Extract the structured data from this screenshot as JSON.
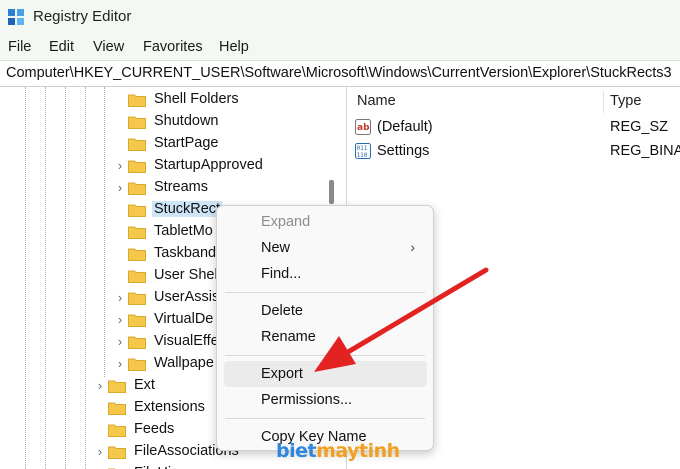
{
  "window": {
    "title": "Registry Editor",
    "app_icon": "registry-editor-icon"
  },
  "menu": [
    "File",
    "Edit",
    "View",
    "Favorites",
    "Help"
  ],
  "address": "Computer\\HKEY_CURRENT_USER\\Software\\Microsoft\\Windows\\CurrentVersion\\Explorer\\StuckRects3",
  "tree": {
    "items": [
      {
        "label": "Shell Folders",
        "expandable": false
      },
      {
        "label": "Shutdown",
        "expandable": false
      },
      {
        "label": "StartPage",
        "expandable": false
      },
      {
        "label": "StartupApproved",
        "expandable": true
      },
      {
        "label": "Streams",
        "expandable": true
      },
      {
        "label": "StuckRect",
        "expandable": false,
        "selected": true
      },
      {
        "label": "TabletMo",
        "expandable": false
      },
      {
        "label": "Taskband",
        "expandable": false
      },
      {
        "label": "User Shel",
        "expandable": false
      },
      {
        "label": "UserAssis",
        "expandable": true
      },
      {
        "label": "VirtualDe",
        "expandable": true
      },
      {
        "label": "VisualEffe",
        "expandable": true
      },
      {
        "label": "Wallpape",
        "expandable": true
      },
      {
        "label": "Ext",
        "expandable": true
      },
      {
        "label": "Extensions",
        "expandable": false
      },
      {
        "label": "Feeds",
        "expandable": false
      },
      {
        "label": "FileAssociations",
        "expandable": true
      },
      {
        "label": "FileHis",
        "expandable": true
      }
    ]
  },
  "values": {
    "headers": {
      "name": "Name",
      "type": "Type"
    },
    "rows": [
      {
        "name": "(Default)",
        "type": "REG_SZ",
        "icon": "string-value-icon"
      },
      {
        "name": "Settings",
        "type": "REG_BINAR",
        "icon": "binary-value-icon"
      }
    ]
  },
  "context_menu": {
    "items": [
      {
        "label": "Expand",
        "disabled": true
      },
      {
        "label": "New",
        "submenu": true
      },
      {
        "label": "Find..."
      },
      {
        "label": "Delete"
      },
      {
        "label": "Rename"
      },
      {
        "label": "Export",
        "highlighted": true
      },
      {
        "label": "Permissions..."
      },
      {
        "label": "Copy Key Name"
      }
    ]
  },
  "watermark": {
    "part1": "biet",
    "part2": "maytinh"
  },
  "colors": {
    "arrow": "#e32222",
    "folder": "#f5c84c",
    "selection": "#cde4f7",
    "titlebar": "#f3f8f2"
  }
}
